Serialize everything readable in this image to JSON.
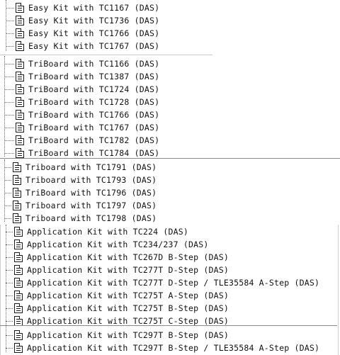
{
  "groups": [
    {
      "items": [
        {
          "label": "Easy Kit with TC1167 (DAS)"
        },
        {
          "label": "Easy Kit with TC1736 (DAS)"
        },
        {
          "label": "Easy Kit with TC1766 (DAS)"
        },
        {
          "label": "Easy Kit with TC1767 (DAS)"
        }
      ]
    },
    {
      "items": [
        {
          "label": "TriBoard with TC1166 (DAS)"
        },
        {
          "label": "TriBoard with TC1387 (DAS)"
        },
        {
          "label": "TriBoard with TC1724 (DAS)"
        },
        {
          "label": "TriBoard with TC1728 (DAS)"
        },
        {
          "label": "TriBoard with TC1766 (DAS)"
        },
        {
          "label": "TriBoard with TC1767 (DAS)"
        },
        {
          "label": "TriBoard with TC1782 (DAS)"
        },
        {
          "label": "TriBoard with TC1784 (DAS)"
        }
      ]
    },
    {
      "items": [
        {
          "label": "Triboard with TC1791 (DAS)"
        },
        {
          "label": "Triboard with TC1793 (DAS)"
        },
        {
          "label": "TriBoard with TC1796 (DAS)"
        },
        {
          "label": "Triboard with TC1797 (DAS)"
        },
        {
          "label": "Triboard with TC1798 (DAS)"
        }
      ]
    },
    {
      "items": [
        {
          "label": "Application Kit with TC224 (DAS)"
        },
        {
          "label": "Application Kit with TC234/237 (DAS)"
        },
        {
          "label": "Application Kit with TC267D B-Step (DAS)"
        },
        {
          "label": "Application Kit with TC277T D-Step (DAS)"
        },
        {
          "label": "Application Kit with TC277T D-Step / TLE35584 A-Step (DAS)"
        },
        {
          "label": "Application Kit with TC275T A-Step (DAS)"
        },
        {
          "label": "Application Kit with TC275T B-Step (DAS)"
        },
        {
          "label": "Application Kit with TC275T C-Step (DAS)"
        },
        {
          "label": "Application Kit with TC297T B-Step (DAS)"
        },
        {
          "label": "Application Kit with TC297T B-Step / TLE35584 A-Step (DAS)"
        }
      ]
    }
  ]
}
